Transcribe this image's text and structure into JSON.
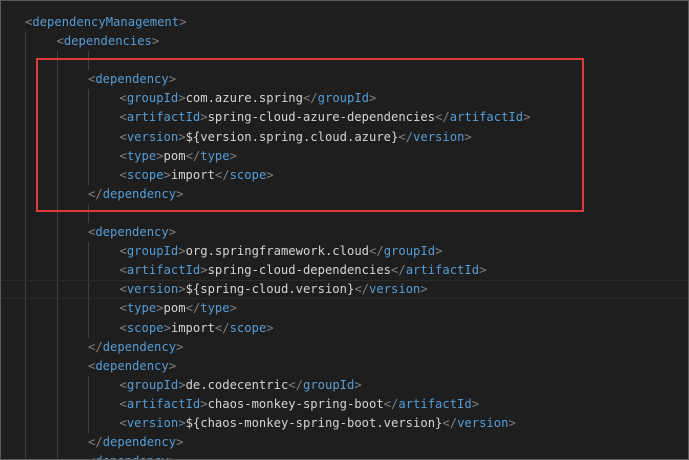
{
  "colors": {
    "background": "#1e1e1e",
    "tag": "#569cd6",
    "bracket": "#808080",
    "text": "#d4d4d4",
    "highlight_border": "#e03b3b"
  },
  "highlight": {
    "from_line": 3,
    "to_line": 9
  },
  "lines": [
    {
      "indent": 0,
      "parts": [
        [
          "b",
          "<"
        ],
        [
          "t",
          "dependencyManagement"
        ],
        [
          "b",
          ">"
        ]
      ]
    },
    {
      "indent": 1,
      "parts": [
        [
          "b",
          "<"
        ],
        [
          "t",
          "dependencies"
        ],
        [
          "b",
          ">"
        ]
      ]
    },
    {
      "indent": 0,
      "parts": []
    },
    {
      "indent": 2,
      "parts": [
        [
          "b",
          "<"
        ],
        [
          "t",
          "dependency"
        ],
        [
          "b",
          ">"
        ]
      ]
    },
    {
      "indent": 3,
      "parts": [
        [
          "b",
          "<"
        ],
        [
          "t",
          "groupId"
        ],
        [
          "b",
          ">"
        ],
        [
          "x",
          "com.azure.spring"
        ],
        [
          "b",
          "</"
        ],
        [
          "t",
          "groupId"
        ],
        [
          "b",
          ">"
        ]
      ]
    },
    {
      "indent": 3,
      "parts": [
        [
          "b",
          "<"
        ],
        [
          "t",
          "artifactId"
        ],
        [
          "b",
          ">"
        ],
        [
          "x",
          "spring-cloud-azure-dependencies"
        ],
        [
          "b",
          "</"
        ],
        [
          "t",
          "artifactId"
        ],
        [
          "b",
          ">"
        ]
      ]
    },
    {
      "indent": 3,
      "parts": [
        [
          "b",
          "<"
        ],
        [
          "t",
          "version"
        ],
        [
          "b",
          ">"
        ],
        [
          "x",
          "${version.spring.cloud.azure}"
        ],
        [
          "b",
          "</"
        ],
        [
          "t",
          "version"
        ],
        [
          "b",
          ">"
        ]
      ]
    },
    {
      "indent": 3,
      "parts": [
        [
          "b",
          "<"
        ],
        [
          "t",
          "type"
        ],
        [
          "b",
          ">"
        ],
        [
          "x",
          "pom"
        ],
        [
          "b",
          "</"
        ],
        [
          "t",
          "type"
        ],
        [
          "b",
          ">"
        ]
      ]
    },
    {
      "indent": 3,
      "parts": [
        [
          "b",
          "<"
        ],
        [
          "t",
          "scope"
        ],
        [
          "b",
          ">"
        ],
        [
          "x",
          "import"
        ],
        [
          "b",
          "</"
        ],
        [
          "t",
          "scope"
        ],
        [
          "b",
          ">"
        ]
      ]
    },
    {
      "indent": 2,
      "parts": [
        [
          "b",
          "</"
        ],
        [
          "t",
          "dependency"
        ],
        [
          "b",
          ">"
        ]
      ]
    },
    {
      "indent": 0,
      "parts": []
    },
    {
      "indent": 2,
      "parts": [
        [
          "b",
          "<"
        ],
        [
          "t",
          "dependency"
        ],
        [
          "b",
          ">"
        ]
      ]
    },
    {
      "indent": 3,
      "parts": [
        [
          "b",
          "<"
        ],
        [
          "t",
          "groupId"
        ],
        [
          "b",
          ">"
        ],
        [
          "x",
          "org.springframework.cloud"
        ],
        [
          "b",
          "</"
        ],
        [
          "t",
          "groupId"
        ],
        [
          "b",
          ">"
        ]
      ]
    },
    {
      "indent": 3,
      "parts": [
        [
          "b",
          "<"
        ],
        [
          "t",
          "artifactId"
        ],
        [
          "b",
          ">"
        ],
        [
          "x",
          "spring-cloud-dependencies"
        ],
        [
          "b",
          "</"
        ],
        [
          "t",
          "artifactId"
        ],
        [
          "b",
          ">"
        ]
      ]
    },
    {
      "indent": 3,
      "parts": [
        [
          "b",
          "<"
        ],
        [
          "t",
          "version"
        ],
        [
          "b",
          ">"
        ],
        [
          "x",
          "${spring-cloud.version}"
        ],
        [
          "b",
          "</"
        ],
        [
          "t",
          "version"
        ],
        [
          "b",
          ">"
        ]
      ],
      "cursor": true
    },
    {
      "indent": 3,
      "parts": [
        [
          "b",
          "<"
        ],
        [
          "t",
          "type"
        ],
        [
          "b",
          ">"
        ],
        [
          "x",
          "pom"
        ],
        [
          "b",
          "</"
        ],
        [
          "t",
          "type"
        ],
        [
          "b",
          ">"
        ]
      ]
    },
    {
      "indent": 3,
      "parts": [
        [
          "b",
          "<"
        ],
        [
          "t",
          "scope"
        ],
        [
          "b",
          ">"
        ],
        [
          "x",
          "import"
        ],
        [
          "b",
          "</"
        ],
        [
          "t",
          "scope"
        ],
        [
          "b",
          ">"
        ]
      ]
    },
    {
      "indent": 2,
      "parts": [
        [
          "b",
          "</"
        ],
        [
          "t",
          "dependency"
        ],
        [
          "b",
          ">"
        ]
      ]
    },
    {
      "indent": 2,
      "parts": [
        [
          "b",
          "<"
        ],
        [
          "t",
          "dependency"
        ],
        [
          "b",
          ">"
        ]
      ]
    },
    {
      "indent": 3,
      "parts": [
        [
          "b",
          "<"
        ],
        [
          "t",
          "groupId"
        ],
        [
          "b",
          ">"
        ],
        [
          "x",
          "de.codecentric"
        ],
        [
          "b",
          "</"
        ],
        [
          "t",
          "groupId"
        ],
        [
          "b",
          ">"
        ]
      ]
    },
    {
      "indent": 3,
      "parts": [
        [
          "b",
          "<"
        ],
        [
          "t",
          "artifactId"
        ],
        [
          "b",
          ">"
        ],
        [
          "x",
          "chaos-monkey-spring-boot"
        ],
        [
          "b",
          "</"
        ],
        [
          "t",
          "artifactId"
        ],
        [
          "b",
          ">"
        ]
      ]
    },
    {
      "indent": 3,
      "parts": [
        [
          "b",
          "<"
        ],
        [
          "t",
          "version"
        ],
        [
          "b",
          ">"
        ],
        [
          "x",
          "${chaos-monkey-spring-boot.version}"
        ],
        [
          "b",
          "</"
        ],
        [
          "t",
          "version"
        ],
        [
          "b",
          ">"
        ]
      ]
    },
    {
      "indent": 2,
      "parts": [
        [
          "b",
          "</"
        ],
        [
          "t",
          "dependency"
        ],
        [
          "b",
          ">"
        ]
      ]
    },
    {
      "indent": 2,
      "parts": [
        [
          "b",
          "<"
        ],
        [
          "t",
          "dependency"
        ],
        [
          "b",
          ">"
        ]
      ]
    }
  ]
}
